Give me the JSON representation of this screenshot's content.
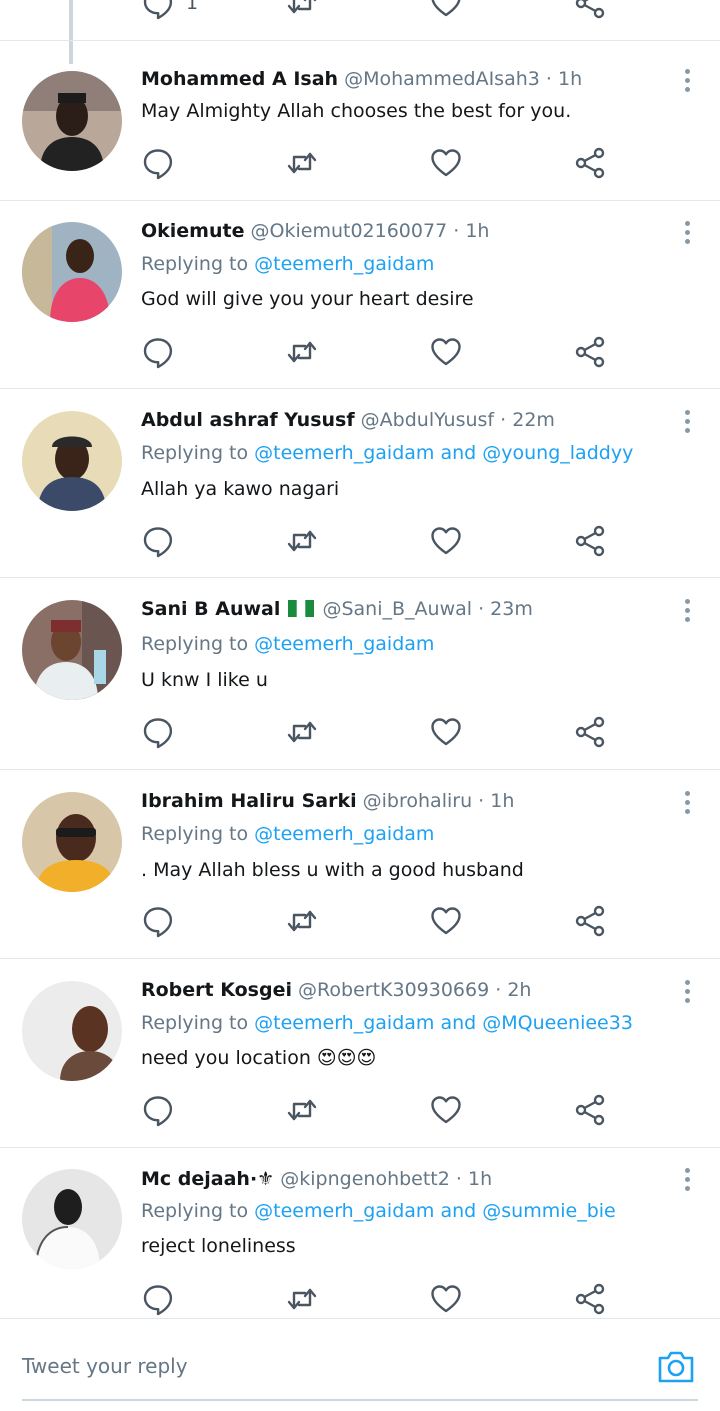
{
  "colors": {
    "accent": "#1da1f2",
    "muted": "#657786",
    "divider": "#e1e8ed",
    "icon": "#4a5562"
  },
  "icons": {
    "reply": "speech-bubble-icon",
    "retweet": "retweet-icon",
    "like": "heart-icon",
    "share": "share-icon",
    "more": "vertical-dots-icon",
    "camera": "camera-icon"
  },
  "top_actions": {
    "reply_count": "1"
  },
  "replying_label": "Replying to",
  "and_label": "and",
  "tweets": [
    {
      "name": "Mohammed A Isah",
      "handle": "@MohammedAIsah3",
      "dot": "·",
      "time": "1h",
      "text": "May Almighty Allah chooses the best for you."
    },
    {
      "name": "Okiemute",
      "handle": "@Okiemut02160077",
      "dot": "·",
      "time": "1h",
      "mention1": "@teemerh_gaidam",
      "text": "God will give you your heart desire"
    },
    {
      "name": "Abdul ashraf Yususf",
      "handle": "@AbdulYususf",
      "dot": "·",
      "time": "22m",
      "mention1": "@teemerh_gaidam",
      "mention2": "@young_laddyy",
      "text": "Allah ya kawo nagari"
    },
    {
      "name": "Sani B Auwal",
      "flag": "nigeria-flag",
      "handle": "@Sani_B_Auwal",
      "dot": "·",
      "time": "23m",
      "mention1": "@teemerh_gaidam",
      "text": "U knw I like u"
    },
    {
      "name": "Ibrahim Haliru Sarki",
      "handle": "@ibrohaliru",
      "dot": "·",
      "time": "1h",
      "mention1": "@teemerh_gaidam",
      "text": ". May Allah bless u with a good husband"
    },
    {
      "name": "Robert Kosgei",
      "handle": "@RobertK30930669",
      "dot": "·",
      "time": "2h",
      "mention1": "@teemerh_gaidam",
      "mention2": "@MQueeniee33",
      "text": "need you location",
      "emoji": "😍😍😍"
    },
    {
      "name": "Mc dejaah·⚜",
      "handle": "@kipngenohbett2",
      "dot": "·",
      "time": "1h",
      "mention1": "@teemerh_gaidam",
      "mention2": "@summie_bie",
      "text": "reject loneliness"
    }
  ],
  "reply_bar": {
    "placeholder": "Tweet your reply"
  }
}
